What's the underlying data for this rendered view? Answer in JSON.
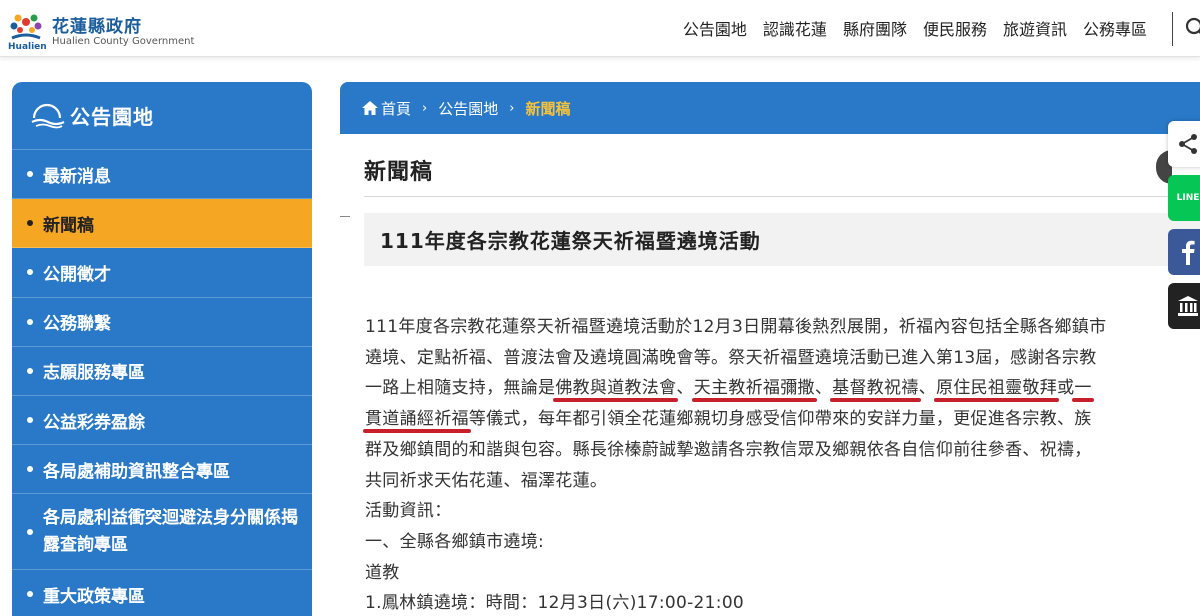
{
  "header": {
    "logo_title": "花蓮縣政府",
    "logo_subtitle": "Hualien County Government",
    "logo_en": "Hualien",
    "nav": [
      "公告園地",
      "認識花蓮",
      "縣府團隊",
      "便民服務",
      "旅遊資訊",
      "公務專區"
    ]
  },
  "sidebar": {
    "title": "公告園地",
    "items": [
      {
        "label": "最新消息"
      },
      {
        "label": "新聞稿"
      },
      {
        "label": "公開徵才"
      },
      {
        "label": "公務聯繫"
      },
      {
        "label": "志願服務專區"
      },
      {
        "label": "公益彩券盈餘"
      },
      {
        "label": "各局處補助資訊整合專區"
      },
      {
        "label": "各局處利益衝突迴避法身分關係揭露查詢專區"
      },
      {
        "label": "重大政策專區"
      }
    ],
    "active_index": 1
  },
  "breadcrumb": {
    "home": "首頁",
    "level1": "公告園地",
    "current": "新聞稿"
  },
  "page": {
    "title": "新聞稿",
    "article_title": "111年度各宗教花蓮祭天祈福暨遶境活動"
  },
  "article": {
    "l1": "111年度各宗教花蓮祭天祈福暨遶境活動於12月3日開幕後熱烈展開，祈福內容包括全縣各鄉鎮市",
    "l2": "遶境、定點祈福、普渡法會及遶境圓滿晚會等。祭天祈福暨遶境活動已進入第13屆，感謝各宗教",
    "l3_a": "一路上相隨支持，無論是",
    "l3_h1": "佛教與道教法會",
    "l3_b": "、",
    "l3_h2": "天主教祈福彌撒",
    "l3_c": "、",
    "l3_h3": "基督教祝禱",
    "l3_d": "、",
    "l3_h4": "原住民祖靈敬拜",
    "l3_e": "或",
    "l3_h5": "一",
    "l4_h": "貫道誦經祈福",
    "l4_b": "等儀式，每年都引領全花蓮鄉親切身感受信仰帶來的安詳力量，更促進各宗教、族",
    "l5": "群及鄉鎮間的和諧與包容。縣長徐榛蔚誠摯邀請各宗教信眾及鄉親依各自信仰前往參香、祝禱，",
    "l6": "共同祈求天佑花蓮、福澤花蓮。",
    "l7": "活動資訊：",
    "l8": "一、全縣各鄉鎮市遶境:",
    "l9": "道教",
    "l10": "1.鳳林鎮遶境：時間：12月3日(六)17:00-21:00"
  },
  "share": {
    "line_label": "LINE"
  },
  "colors": {
    "primary": "#2979c8",
    "active": "#f5a623",
    "highlight": "#c8202a",
    "breadcrumb_current": "#f5c23a"
  }
}
